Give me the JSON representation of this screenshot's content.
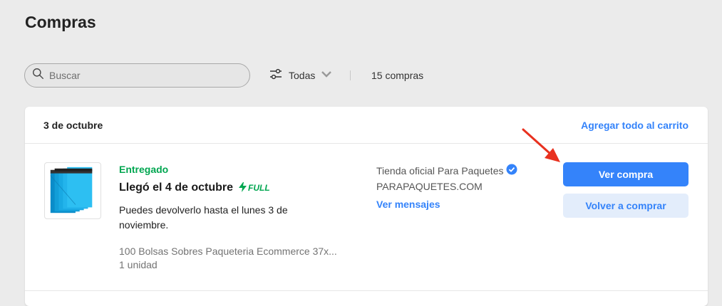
{
  "page": {
    "title": "Compras"
  },
  "search": {
    "placeholder": "Buscar",
    "icon": "search-icon"
  },
  "filter": {
    "label": "Todas",
    "icon": "sliders-icon"
  },
  "count_text": "15 compras",
  "colors": {
    "accent": "#3483fa",
    "success": "#00a650",
    "annotation": "#e8311f"
  },
  "purchase": {
    "date": "3 de octubre",
    "add_all_label": "Agregar todo al carrito",
    "status": "Entregado",
    "arrival": "Llegó el 4 de octubre",
    "full_badge": "FULL",
    "return_text": "Puedes devolverlo hasta el lunes 3 de noviembre.",
    "product_title": "100 Bolsas Sobres Paqueteria Ecommerce 37x...",
    "quantity": "1 unidad",
    "seller": "Tienda oficial Para Paquetes",
    "store_url": "PARAPAQUETES.COM",
    "messages_label": "Ver mensajes",
    "view_button": "Ver compra",
    "rebuy_button": "Volver a comprar"
  }
}
